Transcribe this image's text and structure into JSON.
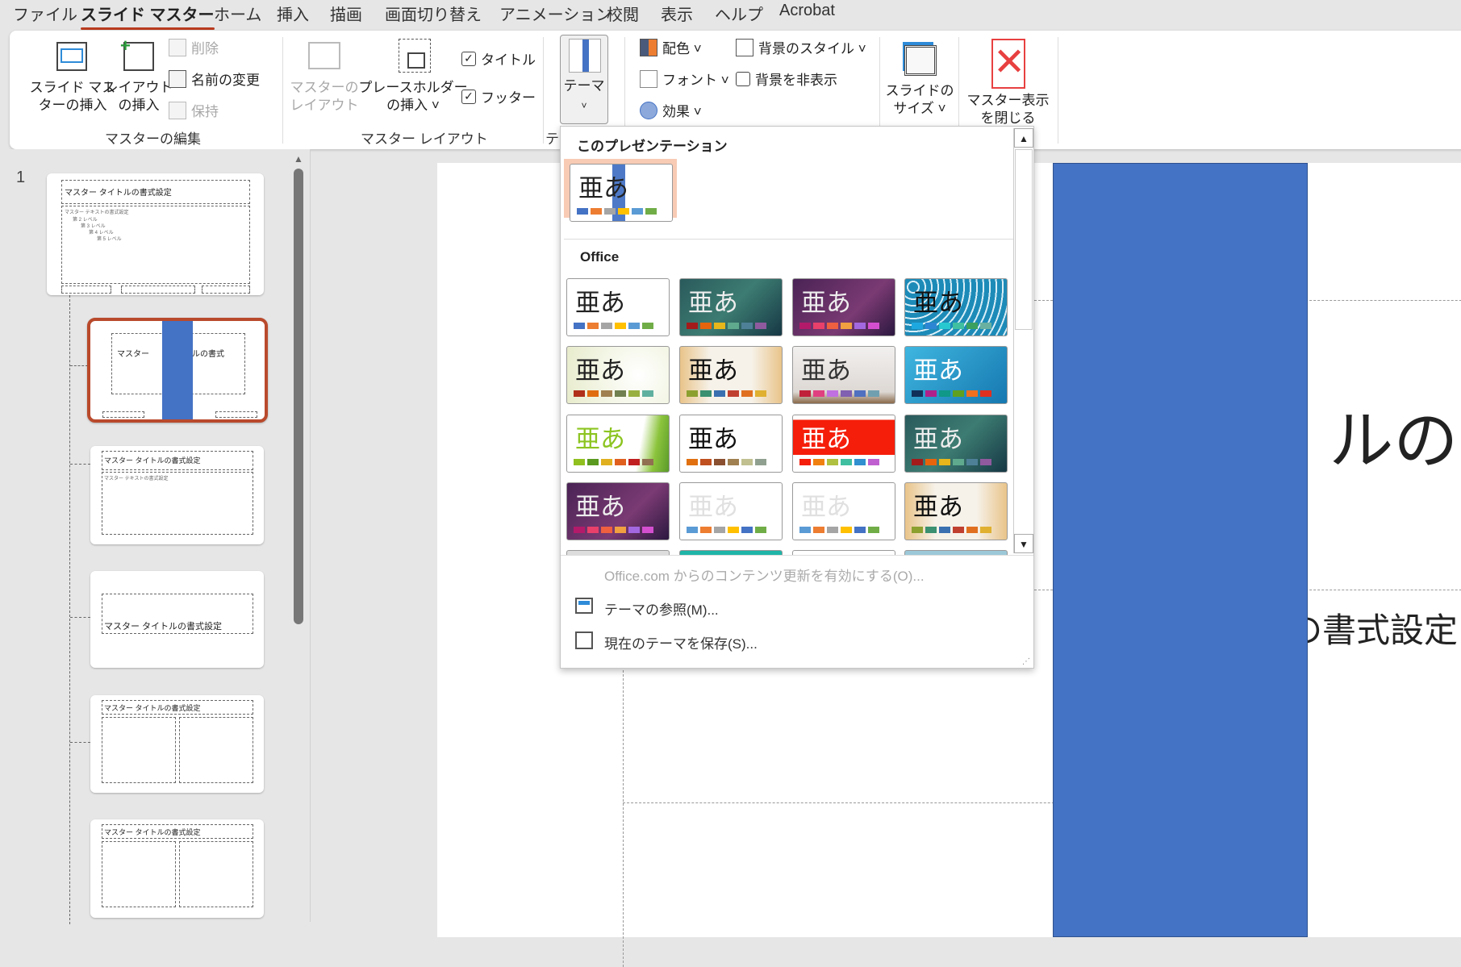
{
  "menu": {
    "tabs": [
      "ファイル",
      "スライド マスター",
      "ホーム",
      "挿入",
      "描画",
      "画面切り替え",
      "アニメーション",
      "校閲",
      "表示",
      "ヘルプ",
      "Acrobat"
    ],
    "active": 1
  },
  "ribbon": {
    "insert_master": [
      "スライド マス",
      "ターの挿入"
    ],
    "insert_layout": [
      "レイアウト",
      "の挿入"
    ],
    "delete": "削除",
    "rename": "名前の変更",
    "preserve": "保持",
    "master_layout": [
      "マスターの",
      "レイアウト"
    ],
    "insert_placeholder": [
      "プレースホルダー",
      "の挿入 ˅"
    ],
    "title_check": "タイトル",
    "footer_check": "フッター",
    "themes": [
      "テーマ",
      "˅"
    ],
    "colors": "配色 ˅",
    "fonts": "フォント ˅",
    "effects": "効果 ˅",
    "bg_styles": "背景のスタイル ˅",
    "hide_bg": "背景を非表示",
    "slide_size": [
      "スライドの",
      "サイズ ˅"
    ],
    "close_master": [
      "マスター表示",
      "を閉じる"
    ],
    "groups": {
      "edit_master": "マスターの編集",
      "master_layout": "マスター レイアウト",
      "edit_theme": "テ"
    }
  },
  "thumbs": {
    "title": "マスター タイトルの書式設定",
    "text": "マスター テキストの書式設定",
    "levels": [
      "第 2 レベル",
      "第 3 レベル",
      "第 4 レベル",
      "第 5 レベル"
    ],
    "slide_number": "1",
    "sel_left": "マスター",
    "sel_right": "ルの書式"
  },
  "slide": {
    "title_fragment": "ト ルの",
    "subtitle_fragment": "の書式設定",
    "accent": "#4472c4"
  },
  "dropdown": {
    "section_current": "このプレゼンテーション",
    "section_office": "Office",
    "tile_text": "亜あ",
    "current": {
      "bg": "#ffffff",
      "fg": "#222222",
      "sw": [
        "#4472c4",
        "#ed7d31",
        "#a5a5a5",
        "#ffc000",
        "#5b9bd5",
        "#70ad47"
      ]
    },
    "office": [
      {
        "bg": "#ffffff",
        "fg": "#222",
        "sw": [
          "#4472c4",
          "#ed7d31",
          "#a5a5a5",
          "#ffc000",
          "#5b9bd5",
          "#70ad47"
        ]
      },
      {
        "bg": "linear-gradient(135deg,#2a5a5c,#3d7c72 50%,#163845)",
        "fg": "#eee",
        "sw": [
          "#a31b1b",
          "#e8640c",
          "#e6b61a",
          "#5fa98e",
          "#4e8098",
          "#8f5a9e"
        ]
      },
      {
        "bg": "linear-gradient(135deg,#4a2355,#7a3a73 60%,#2c1840)",
        "fg": "#eee",
        "sw": [
          "#b31a6a",
          "#e8406a",
          "#ee6040",
          "#f0a040",
          "#a368e0",
          "#d44fd0"
        ]
      },
      {
        "bg": "repeating-radial-gradient(circle at 10px 10px,#1d8bb8 0 6px,#d8eef7 6px 8px)",
        "fg": "#111",
        "sw": [
          "#1ea8e0",
          "#2d86d3",
          "#28c8d0",
          "#40c0a0",
          "#3aa060",
          "#6ab0a0"
        ]
      },
      {
        "bg": "radial-gradient(circle at 70% 50%,#fff,#e8eccc)",
        "fg": "#222",
        "sw": [
          "#b0301a",
          "#e06c10",
          "#a08050",
          "#708050",
          "#98b040",
          "#60b0a0"
        ]
      },
      {
        "bg": "linear-gradient(90deg,#e9c48a,#f6f2ea 30%,#f6f2ea 70%,#e9c48a)",
        "fg": "#111",
        "sw": [
          "#8ca030",
          "#3a9070",
          "#3a70b0",
          "#c04030",
          "#e07020",
          "#e0b030"
        ]
      },
      {
        "bg": "linear-gradient(180deg,#f2f0ef,#ddd8d4 80%,#8a6a4a)",
        "fg": "#333",
        "sw": [
          "#c0203a",
          "#e04080",
          "#c070e0",
          "#8060b0",
          "#5070c0",
          "#70a0b0"
        ]
      },
      {
        "bg": "linear-gradient(135deg,#3fb6e0,#1678b0)",
        "fg": "#fff",
        "sw": [
          "#10305a",
          "#b0208a",
          "#109888",
          "#60a020",
          "#f07020",
          "#e03020"
        ]
      },
      {
        "bg": "linear-gradient(100deg,#fff 70%,#8cc43c 85%,#5a9a2a)",
        "fg": "#8cc420",
        "sw": [
          "#90c020",
          "#5a9a20",
          "#e0b020",
          "#e06020",
          "#c02020",
          "#907050"
        ]
      },
      {
        "bg": "#ffffff",
        "fg": "#111",
        "sw": [
          "#e07010",
          "#c05020",
          "#8a5030",
          "#a08050",
          "#c0c090",
          "#90a090"
        ]
      },
      {
        "bg": "linear-gradient(180deg,#fff 8%,#f51e0a 8%,#f51e0a 70%,#fff 70%)",
        "fg": "#fff",
        "sw": [
          "#f51e0a",
          "#f08010",
          "#b0c040",
          "#40c0a0",
          "#3090d0",
          "#c060d0"
        ]
      },
      {
        "bg": "linear-gradient(135deg,#2a5a5c,#3d7c72 50%,#163845)",
        "fg": "#eee",
        "sw": [
          "#a31b1b",
          "#e8640c",
          "#e6b61a",
          "#5fa98e",
          "#4e8098",
          "#8f5a9e"
        ]
      },
      {
        "bg": "linear-gradient(135deg,#4a2355,#7a3a73 60%,#2c1840)",
        "fg": "#eee",
        "sw": [
          "#b31a6a",
          "#e8406a",
          "#ee6040",
          "#f0a040",
          "#a368e0",
          "#d44fd0"
        ]
      },
      {
        "bg": "#ffffff",
        "fg": "#e0e0e0",
        "sw": [
          "#5b9bd5",
          "#ed7d31",
          "#a5a5a5",
          "#ffc000",
          "#4472c4",
          "#70ad47"
        ]
      },
      {
        "bg": "#ffffff",
        "fg": "#e0e0e0",
        "sw": [
          "#5b9bd5",
          "#ed7d31",
          "#a5a5a5",
          "#ffc000",
          "#4472c4",
          "#70ad47"
        ]
      },
      {
        "bg": "linear-gradient(90deg,#e9c48a,#f6f2ea 30%,#f6f2ea 70%,#e9c48a)",
        "fg": "#111",
        "sw": [
          "#8ca030",
          "#3a9070",
          "#3a70b0",
          "#c04030",
          "#e07020",
          "#e0b030"
        ]
      }
    ],
    "enable_updates": "Office.com からのコンテンツ更新を有効にする(O)...",
    "browse": "テーマの参照(M)...",
    "save": "現在のテーマを保存(S)..."
  }
}
